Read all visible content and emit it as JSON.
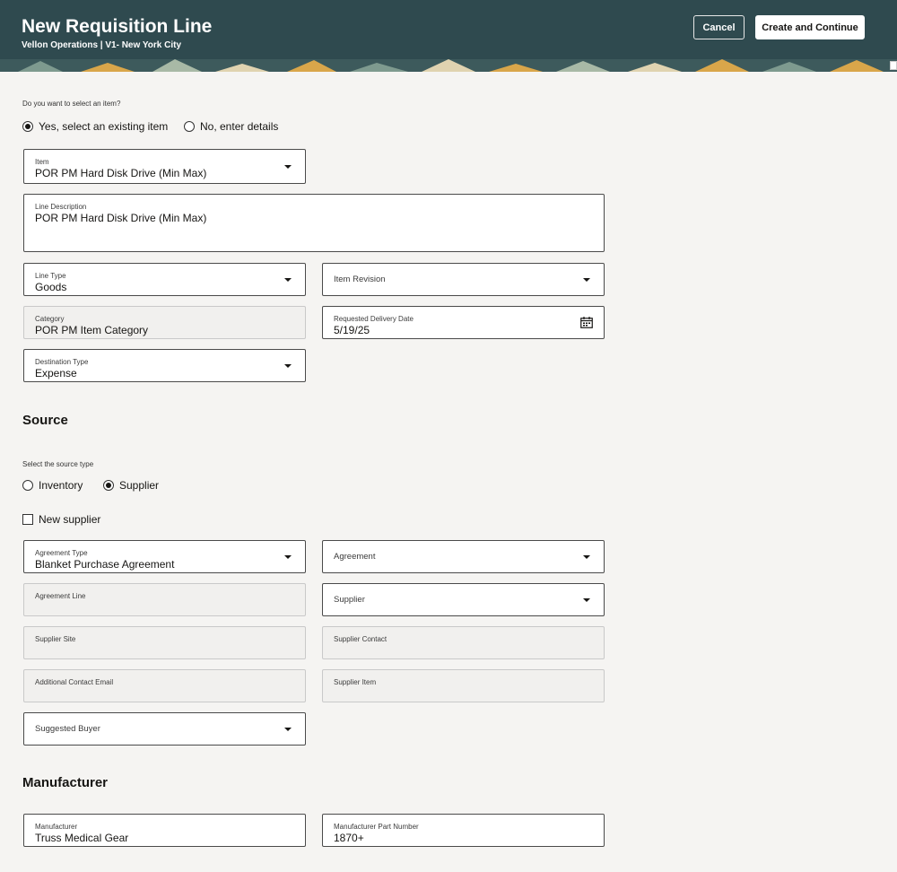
{
  "header": {
    "title": "New Requisition Line",
    "subtitle": "Vellon Operations | V1- New York City",
    "cancel_label": "Cancel",
    "create_label": "Create and Continue"
  },
  "item_choice": {
    "question": "Do you want to select an item?",
    "options": [
      "Yes, select an existing item",
      "No, enter details"
    ],
    "selected": "Yes, select an existing item"
  },
  "fields": {
    "item": {
      "label": "Item",
      "value": "POR PM Hard Disk Drive (Min Max)"
    },
    "line_description": {
      "label": "Line Description",
      "value": "POR PM Hard Disk Drive (Min Max)"
    },
    "line_type": {
      "label": "Line Type",
      "value": "Goods"
    },
    "item_revision": {
      "label": "Item Revision"
    },
    "category": {
      "label": "Category",
      "value": "POR PM Item Category"
    },
    "requested_delivery_date": {
      "label": "Requested Delivery Date",
      "value": "5/19/25"
    },
    "destination_type": {
      "label": "Destination Type",
      "value": "Expense"
    }
  },
  "source": {
    "heading": "Source",
    "question": "Select the source type",
    "options": [
      "Inventory",
      "Supplier"
    ],
    "selected": "Supplier",
    "new_supplier_label": "New supplier",
    "agreement_type": {
      "label": "Agreement Type",
      "value": "Blanket Purchase Agreement"
    },
    "agreement": {
      "label": "Agreement"
    },
    "agreement_line": {
      "label": "Agreement Line"
    },
    "supplier": {
      "label": "Supplier"
    },
    "supplier_site": {
      "label": "Supplier Site"
    },
    "supplier_contact": {
      "label": "Supplier Contact"
    },
    "additional_contact_email": {
      "label": "Additional Contact Email"
    },
    "supplier_item": {
      "label": "Supplier Item"
    },
    "suggested_buyer": {
      "label": "Suggested Buyer"
    }
  },
  "manufacturer": {
    "heading": "Manufacturer",
    "manufacturer": {
      "label": "Manufacturer",
      "value": "Truss Medical Gear"
    },
    "part_number": {
      "label": "Manufacturer Part Number",
      "value": "1870+"
    }
  },
  "colors": {
    "header_bg": "#2f4a4f",
    "page_bg": "#f5f4f2",
    "pattern_accent": "#d9a64a"
  }
}
